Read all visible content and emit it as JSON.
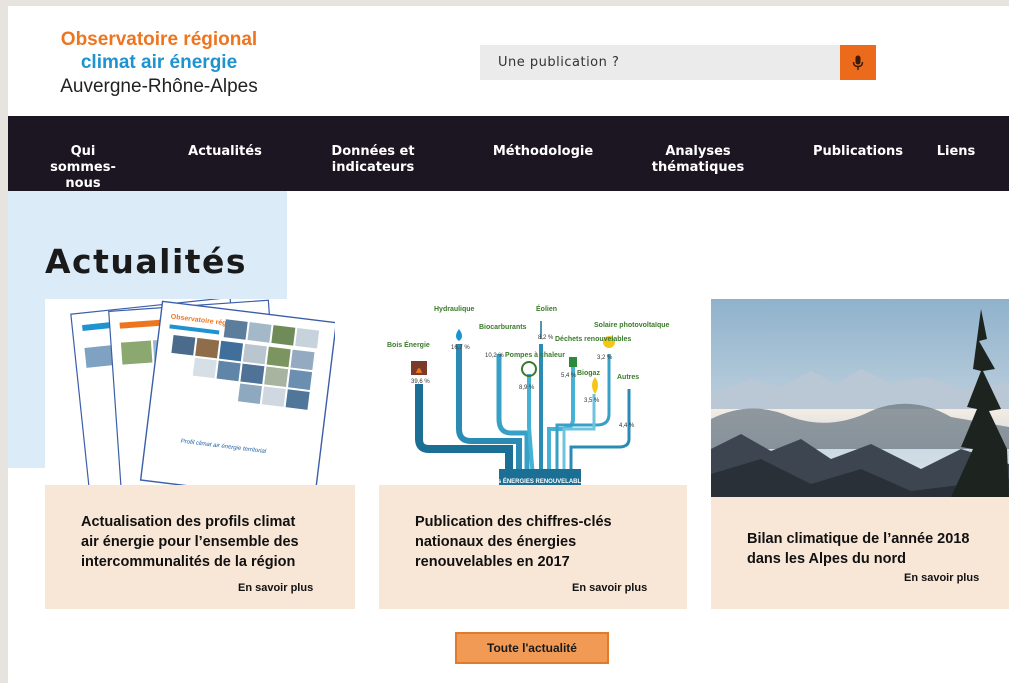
{
  "logo": {
    "line1": "Observatoire régional",
    "line2": "climat air énergie",
    "line3": "Auvergne-Rhône-Alpes"
  },
  "search": {
    "placeholder": "Une publication ?"
  },
  "nav": {
    "items": [
      {
        "line1": "Qui sommes-",
        "line2": "nous"
      },
      {
        "line1": "Actualités",
        "line2": ""
      },
      {
        "line1": "Données et",
        "line2": "indicateurs"
      },
      {
        "line1": "Méthodologie",
        "line2": ""
      },
      {
        "line1": "Analyses",
        "line2": "thématiques"
      },
      {
        "line1": "Publications",
        "line2": ""
      },
      {
        "line1": "Liens",
        "line2": ""
      }
    ]
  },
  "page_title": "Actualités",
  "cards": [
    {
      "title_lines": [
        "Actualisation des profils climat",
        "air énergie pour l’ensemble des",
        "intercommunalités de la région"
      ],
      "more": "En savoir plus",
      "doc_caption": "Profil climat air énergie territorial",
      "doc_header": "Observatoire régional"
    },
    {
      "title_lines": [
        "Publication des chiffres-clés",
        "nationaux des énergies",
        "renouvelables en 2017"
      ],
      "more": "En savoir plus",
      "infographic": {
        "labels": [
          "Hydraulique",
          "Biocarburants",
          "Éolien",
          "Solaire photovoltaïque",
          "Bois Énergie",
          "Pompes à chaleur",
          "Déchets renouvelables",
          "Biogaz",
          "Autres"
        ],
        "values": [
          "16,7 %",
          "10,2 %",
          "8,2 %",
          "3,2 %",
          "39,6 %",
          "8,9 %",
          "5,4 %",
          "3,5 %",
          "4,4 %"
        ],
        "footer": "Les ÉNERGIES RENOUVELABLES"
      }
    },
    {
      "title_lines": [
        "Bilan climatique de l’année 2018",
        "dans les Alpes du nord"
      ],
      "more": "En savoir plus"
    }
  ],
  "all_news_button": "Toute l'actualité",
  "colors": {
    "orange": "#ee7520",
    "blue": "#1e93d0",
    "nav_bg": "#1b1622",
    "card_bg": "#f8e6d6",
    "accent_light_blue": "#dcebf8"
  }
}
